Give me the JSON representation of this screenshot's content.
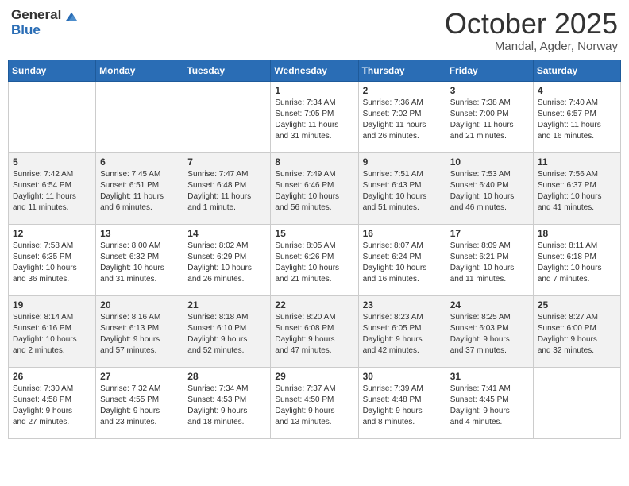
{
  "header": {
    "logo_general": "General",
    "logo_blue": "Blue",
    "month_title": "October 2025",
    "location": "Mandal, Agder, Norway"
  },
  "days_of_week": [
    "Sunday",
    "Monday",
    "Tuesday",
    "Wednesday",
    "Thursday",
    "Friday",
    "Saturday"
  ],
  "weeks": [
    [
      {
        "day": "",
        "info": ""
      },
      {
        "day": "",
        "info": ""
      },
      {
        "day": "",
        "info": ""
      },
      {
        "day": "1",
        "info": "Sunrise: 7:34 AM\nSunset: 7:05 PM\nDaylight: 11 hours\nand 31 minutes."
      },
      {
        "day": "2",
        "info": "Sunrise: 7:36 AM\nSunset: 7:02 PM\nDaylight: 11 hours\nand 26 minutes."
      },
      {
        "day": "3",
        "info": "Sunrise: 7:38 AM\nSunset: 7:00 PM\nDaylight: 11 hours\nand 21 minutes."
      },
      {
        "day": "4",
        "info": "Sunrise: 7:40 AM\nSunset: 6:57 PM\nDaylight: 11 hours\nand 16 minutes."
      }
    ],
    [
      {
        "day": "5",
        "info": "Sunrise: 7:42 AM\nSunset: 6:54 PM\nDaylight: 11 hours\nand 11 minutes."
      },
      {
        "day": "6",
        "info": "Sunrise: 7:45 AM\nSunset: 6:51 PM\nDaylight: 11 hours\nand 6 minutes."
      },
      {
        "day": "7",
        "info": "Sunrise: 7:47 AM\nSunset: 6:48 PM\nDaylight: 11 hours\nand 1 minute."
      },
      {
        "day": "8",
        "info": "Sunrise: 7:49 AM\nSunset: 6:46 PM\nDaylight: 10 hours\nand 56 minutes."
      },
      {
        "day": "9",
        "info": "Sunrise: 7:51 AM\nSunset: 6:43 PM\nDaylight: 10 hours\nand 51 minutes."
      },
      {
        "day": "10",
        "info": "Sunrise: 7:53 AM\nSunset: 6:40 PM\nDaylight: 10 hours\nand 46 minutes."
      },
      {
        "day": "11",
        "info": "Sunrise: 7:56 AM\nSunset: 6:37 PM\nDaylight: 10 hours\nand 41 minutes."
      }
    ],
    [
      {
        "day": "12",
        "info": "Sunrise: 7:58 AM\nSunset: 6:35 PM\nDaylight: 10 hours\nand 36 minutes."
      },
      {
        "day": "13",
        "info": "Sunrise: 8:00 AM\nSunset: 6:32 PM\nDaylight: 10 hours\nand 31 minutes."
      },
      {
        "day": "14",
        "info": "Sunrise: 8:02 AM\nSunset: 6:29 PM\nDaylight: 10 hours\nand 26 minutes."
      },
      {
        "day": "15",
        "info": "Sunrise: 8:05 AM\nSunset: 6:26 PM\nDaylight: 10 hours\nand 21 minutes."
      },
      {
        "day": "16",
        "info": "Sunrise: 8:07 AM\nSunset: 6:24 PM\nDaylight: 10 hours\nand 16 minutes."
      },
      {
        "day": "17",
        "info": "Sunrise: 8:09 AM\nSunset: 6:21 PM\nDaylight: 10 hours\nand 11 minutes."
      },
      {
        "day": "18",
        "info": "Sunrise: 8:11 AM\nSunset: 6:18 PM\nDaylight: 10 hours\nand 7 minutes."
      }
    ],
    [
      {
        "day": "19",
        "info": "Sunrise: 8:14 AM\nSunset: 6:16 PM\nDaylight: 10 hours\nand 2 minutes."
      },
      {
        "day": "20",
        "info": "Sunrise: 8:16 AM\nSunset: 6:13 PM\nDaylight: 9 hours\nand 57 minutes."
      },
      {
        "day": "21",
        "info": "Sunrise: 8:18 AM\nSunset: 6:10 PM\nDaylight: 9 hours\nand 52 minutes."
      },
      {
        "day": "22",
        "info": "Sunrise: 8:20 AM\nSunset: 6:08 PM\nDaylight: 9 hours\nand 47 minutes."
      },
      {
        "day": "23",
        "info": "Sunrise: 8:23 AM\nSunset: 6:05 PM\nDaylight: 9 hours\nand 42 minutes."
      },
      {
        "day": "24",
        "info": "Sunrise: 8:25 AM\nSunset: 6:03 PM\nDaylight: 9 hours\nand 37 minutes."
      },
      {
        "day": "25",
        "info": "Sunrise: 8:27 AM\nSunset: 6:00 PM\nDaylight: 9 hours\nand 32 minutes."
      }
    ],
    [
      {
        "day": "26",
        "info": "Sunrise: 7:30 AM\nSunset: 4:58 PM\nDaylight: 9 hours\nand 27 minutes."
      },
      {
        "day": "27",
        "info": "Sunrise: 7:32 AM\nSunset: 4:55 PM\nDaylight: 9 hours\nand 23 minutes."
      },
      {
        "day": "28",
        "info": "Sunrise: 7:34 AM\nSunset: 4:53 PM\nDaylight: 9 hours\nand 18 minutes."
      },
      {
        "day": "29",
        "info": "Sunrise: 7:37 AM\nSunset: 4:50 PM\nDaylight: 9 hours\nand 13 minutes."
      },
      {
        "day": "30",
        "info": "Sunrise: 7:39 AM\nSunset: 4:48 PM\nDaylight: 9 hours\nand 8 minutes."
      },
      {
        "day": "31",
        "info": "Sunrise: 7:41 AM\nSunset: 4:45 PM\nDaylight: 9 hours\nand 4 minutes."
      },
      {
        "day": "",
        "info": ""
      }
    ]
  ]
}
